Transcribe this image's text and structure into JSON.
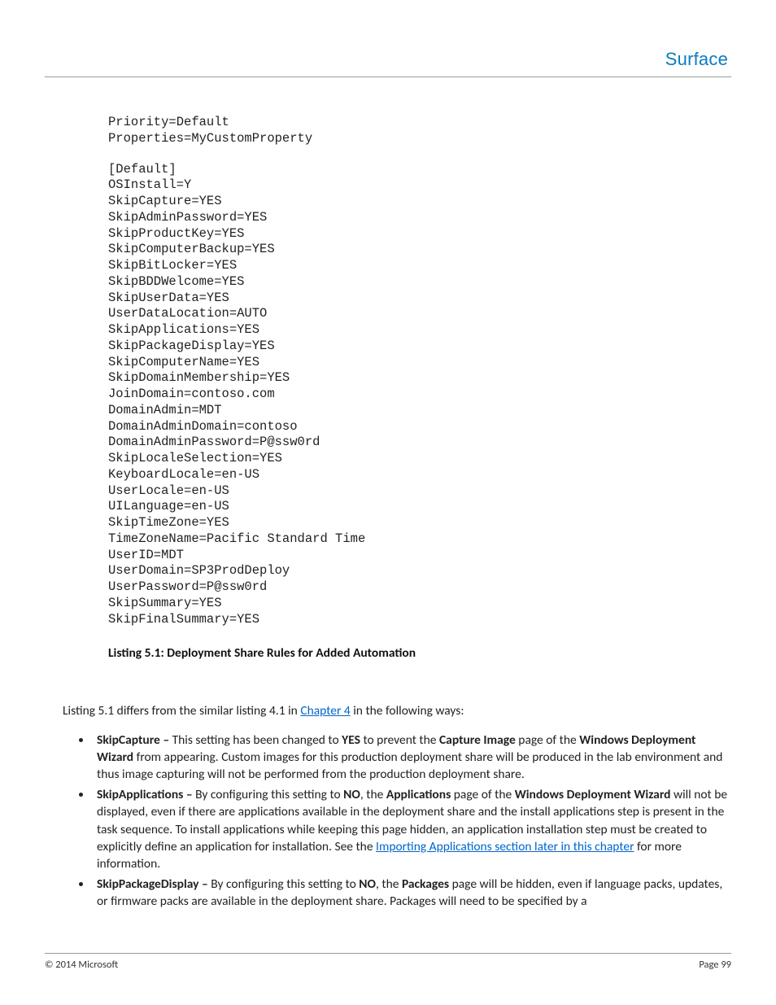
{
  "header": {
    "brand": "Surface"
  },
  "code": {
    "block1": "Priority=Default\nProperties=MyCustomProperty",
    "block2": "[Default]\nOSInstall=Y\nSkipCapture=YES\nSkipAdminPassword=YES\nSkipProductKey=YES\nSkipComputerBackup=YES\nSkipBitLocker=YES\nSkipBDDWelcome=YES\nSkipUserData=YES\nUserDataLocation=AUTO\nSkipApplications=YES\nSkipPackageDisplay=YES\nSkipComputerName=YES\nSkipDomainMembership=YES\nJoinDomain=contoso.com\nDomainAdmin=MDT\nDomainAdminDomain=contoso\nDomainAdminPassword=P@ssw0rd\nSkipLocaleSelection=YES\nKeyboardLocale=en-US\nUserLocale=en-US\nUILanguage=en-US\nSkipTimeZone=YES\nTimeZoneName=Pacific Standard Time\nUserID=MDT\nUserDomain=SP3ProdDeploy\nUserPassword=P@ssw0rd\nSkipSummary=YES\nSkipFinalSummary=YES"
  },
  "caption": "Listing 5.1: Deployment Share Rules for Added Automation",
  "intro": {
    "pre": "Listing 5.1 differs from the similar listing 4.1 in ",
    "link": "Chapter 4",
    "post": " in the following ways:"
  },
  "bullets": {
    "b1": {
      "label": "SkipCapture – ",
      "t1": "This setting has been changed to ",
      "yes": "YES",
      "t2": " to prevent the ",
      "ci": "Capture Image",
      "t3": " page of the ",
      "wdw": "Windows Deployment Wizard",
      "t4": " from appearing. Custom images for this production deployment share will be produced in the lab environment and thus image capturing will not be performed from the production deployment share."
    },
    "b2": {
      "label": "SkipApplications – ",
      "t1": "By configuring this setting to ",
      "no": "NO",
      "t2": ", the ",
      "apps": "Applications",
      "t3": " page of the ",
      "wdw": "Windows Deployment Wizard",
      "t4": " will not be displayed, even if there are applications available in the deployment share and the install applications step is present in the task sequence. To install applications while keeping this page hidden, an application installation step must be created to explicitly define an application for installation. See the ",
      "link": "Importing Applications section later in this chapter",
      "t5": " for more information."
    },
    "b3": {
      "label": "SkipPackageDisplay – ",
      "t1": "By configuring this setting to ",
      "no": "NO",
      "t2": ", the ",
      "pk": "Packages",
      "t3": " page will be hidden, even if language packs, updates, or firmware packs are available in the deployment share. Packages will need to be specified by a"
    }
  },
  "footer": {
    "copyright": "© 2014 Microsoft",
    "page": "Page 99"
  }
}
